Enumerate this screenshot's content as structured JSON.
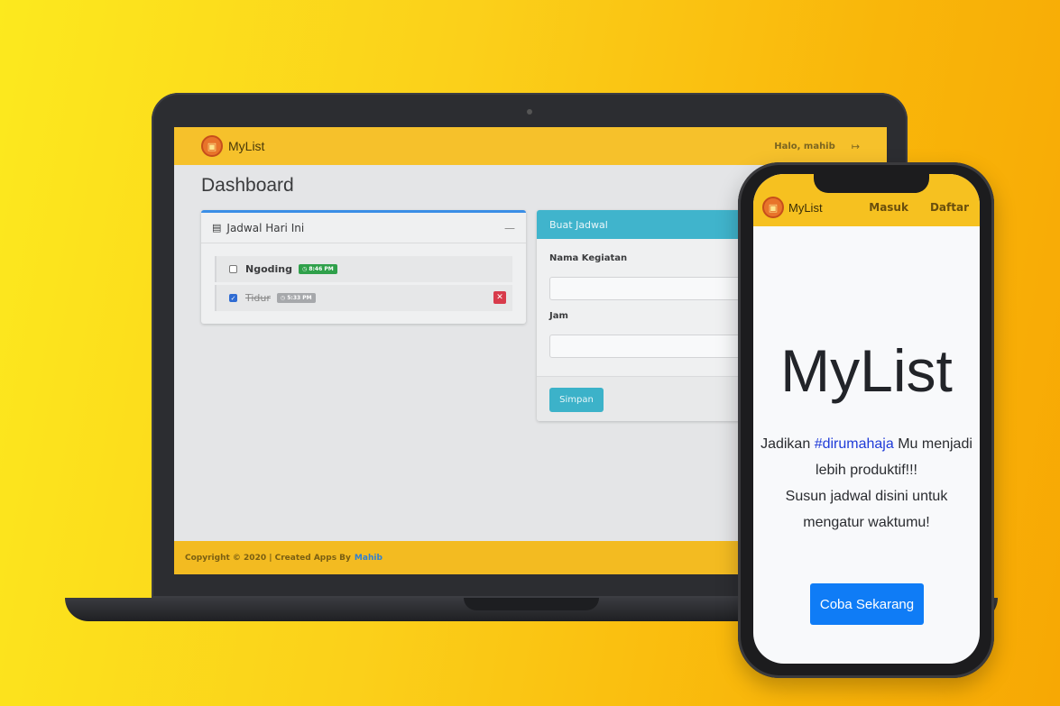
{
  "laptop": {
    "nav": {
      "brand": "MyList",
      "greeting": "Halo, mahib",
      "logout_icon": "sign-out-icon"
    },
    "page_title": "Dashboard",
    "schedule_card": {
      "title": "Jadwal Hari Ini",
      "minimize": "—",
      "items": [
        {
          "label": "Ngoding",
          "time": "◷ 8:46 PM",
          "checked": false
        },
        {
          "label": "Tidur",
          "time": "◷ 5:33 PM",
          "checked": true
        }
      ]
    },
    "form_card": {
      "title": "Buat Jadwal",
      "activity_label": "Nama Kegiatan",
      "time_label": "Jam",
      "submit_label": "Simpan"
    },
    "footer": {
      "text": "Copyright © 2020 | Created Apps By",
      "author": "Mahib"
    }
  },
  "phone": {
    "nav": {
      "brand": "MyList",
      "login": "Masuk",
      "register": "Daftar"
    },
    "hero_title": "MyList",
    "desc_before": "Jadikan",
    "desc_tag": "#dirumahaja",
    "desc_after": "Mu menjadi lebih produktif!!!",
    "desc_line2": "Susun jadwal disini untuk mengatur waktumu!",
    "cta_label": "Coba Sekarang"
  },
  "colors": {
    "accent": "#f6c12b",
    "primary_button": "#0f7cf6",
    "info": "#40b4cc",
    "danger": "#d83b4b",
    "success": "#2fa04a"
  }
}
